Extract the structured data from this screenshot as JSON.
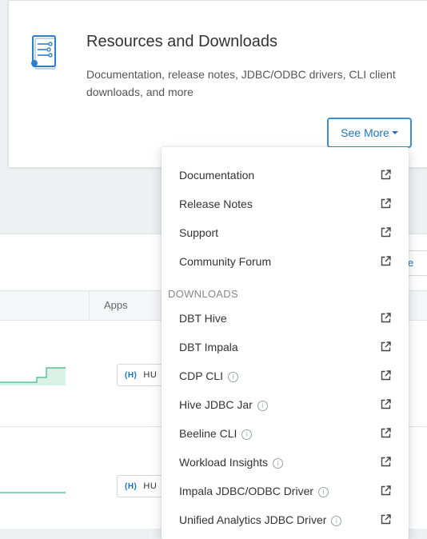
{
  "card": {
    "title": "Resources and Downloads",
    "description": "Documentation, release notes, JDBC/ODBC drivers, CLI client downloads, and more",
    "see_more_label": "See More",
    "icon": "document-list-icon"
  },
  "background": {
    "apps_header": "Apps",
    "partial_button": "e",
    "rows": [
      {
        "app_tag": "HU"
      },
      {
        "app_tag": "HU"
      }
    ]
  },
  "menu": {
    "items": [
      {
        "label": "Documentation",
        "info": false,
        "icon": "external-link-icon"
      },
      {
        "label": "Release Notes",
        "info": false,
        "icon": "external-link-icon"
      },
      {
        "label": "Support",
        "info": false,
        "icon": "external-link-icon"
      },
      {
        "label": "Community Forum",
        "info": false,
        "icon": "external-link-icon"
      }
    ],
    "section_title": "DOWNLOADS",
    "downloads": [
      {
        "label": "DBT Hive",
        "info": false,
        "icon": "external-link-icon"
      },
      {
        "label": "DBT Impala",
        "info": false,
        "icon": "external-link-icon"
      },
      {
        "label": "CDP CLI",
        "info": true,
        "icon": "external-link-icon"
      },
      {
        "label": "Hive JDBC Jar",
        "info": true,
        "icon": "external-link-icon"
      },
      {
        "label": "Beeline CLI",
        "info": true,
        "icon": "external-link-icon"
      },
      {
        "label": "Workload Insights",
        "info": true,
        "icon": "external-link-icon"
      },
      {
        "label": "Impala JDBC/ODBC Driver",
        "info": true,
        "icon": "external-link-icon"
      },
      {
        "label": "Unified Analytics JDBC Driver",
        "info": true,
        "icon": "external-link-icon"
      }
    ]
  },
  "colors": {
    "accent": "#1f74c0",
    "accent_border": "#3a8fd6",
    "sparkline": "#3fb58e"
  }
}
